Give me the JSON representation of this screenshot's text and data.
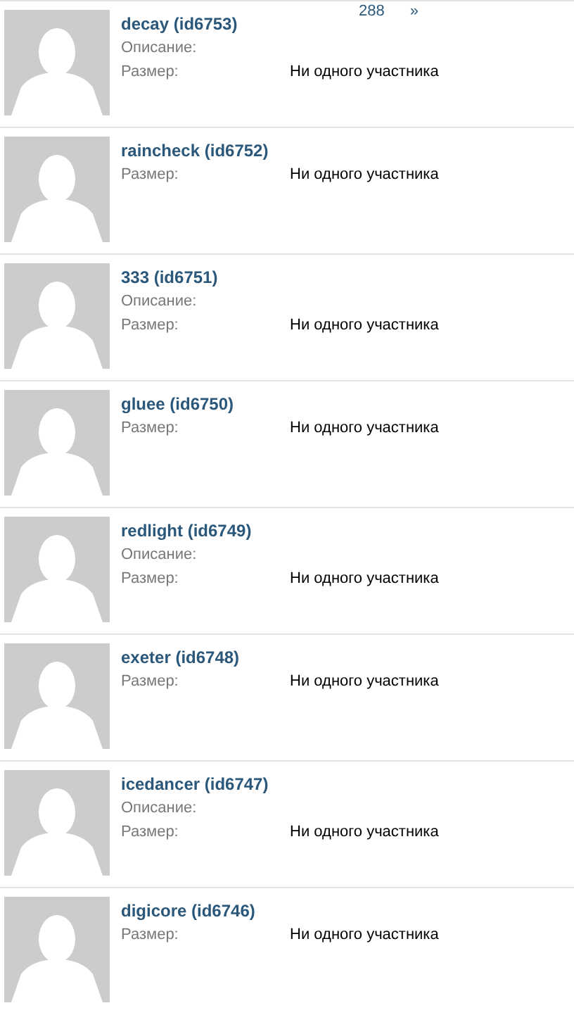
{
  "pager": {
    "page": "288",
    "next": "»"
  },
  "groups": [
    {
      "title": "decay (id6753)",
      "fields": [
        {
          "label": "Описание:"
        },
        {
          "label": "Размер:",
          "value": "Ни одного участника"
        }
      ]
    },
    {
      "title": "raincheck (id6752)",
      "fields": [
        {
          "label": "Размер:",
          "value": "Ни одного участника"
        }
      ]
    },
    {
      "title": "333 (id6751)",
      "fields": [
        {
          "label": "Описание:"
        },
        {
          "label": "Размер:",
          "value": "Ни одного участника"
        }
      ]
    },
    {
      "title": "gluee (id6750)",
      "fields": [
        {
          "label": "Размер:",
          "value": "Ни одного участника"
        }
      ]
    },
    {
      "title": "redlight (id6749)",
      "fields": [
        {
          "label": "Описание:"
        },
        {
          "label": "Размер:",
          "value": "Ни одного участника"
        }
      ]
    },
    {
      "title": "exeter (id6748)",
      "fields": [
        {
          "label": "Размер:",
          "value": "Ни одного участника"
        }
      ]
    },
    {
      "title": "icedancer (id6747)",
      "fields": [
        {
          "label": "Описание:"
        },
        {
          "label": "Размер:",
          "value": "Ни одного участника"
        }
      ]
    },
    {
      "title": "digicore (id6746)",
      "fields": [
        {
          "label": "Размер:",
          "value": "Ни одного участника"
        }
      ]
    }
  ]
}
